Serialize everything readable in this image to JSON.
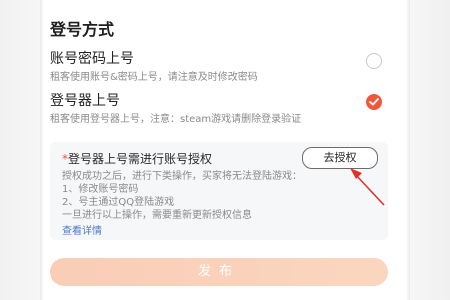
{
  "section_title": "登号方式",
  "options": [
    {
      "title": "账号密码上号",
      "description": "租客使用账号&密码上号，请注意及时修改密码",
      "selected": false
    },
    {
      "title": "登号器上号",
      "description": "租客使用登号器上号，注意：steam游戏请删除登录验证",
      "selected": true
    }
  ],
  "auth": {
    "star": "*",
    "heading": "登号器上号需进行账号授权",
    "button_label": "去授权",
    "lines": [
      "授权成功之后，进行下类操作，买家将无法登陆游戏：",
      "1、修改账号密码",
      "2、号主通过QQ登陆游戏",
      "一旦进行以上操作，需要重新更新授权信息"
    ],
    "details_link": "查看详情"
  },
  "publish_button": "发布",
  "colors": {
    "accent": "#f0573d",
    "link": "#4a78c8",
    "publish_bg": "#f9cdb6",
    "annotation_arrow": "#e0302a"
  }
}
